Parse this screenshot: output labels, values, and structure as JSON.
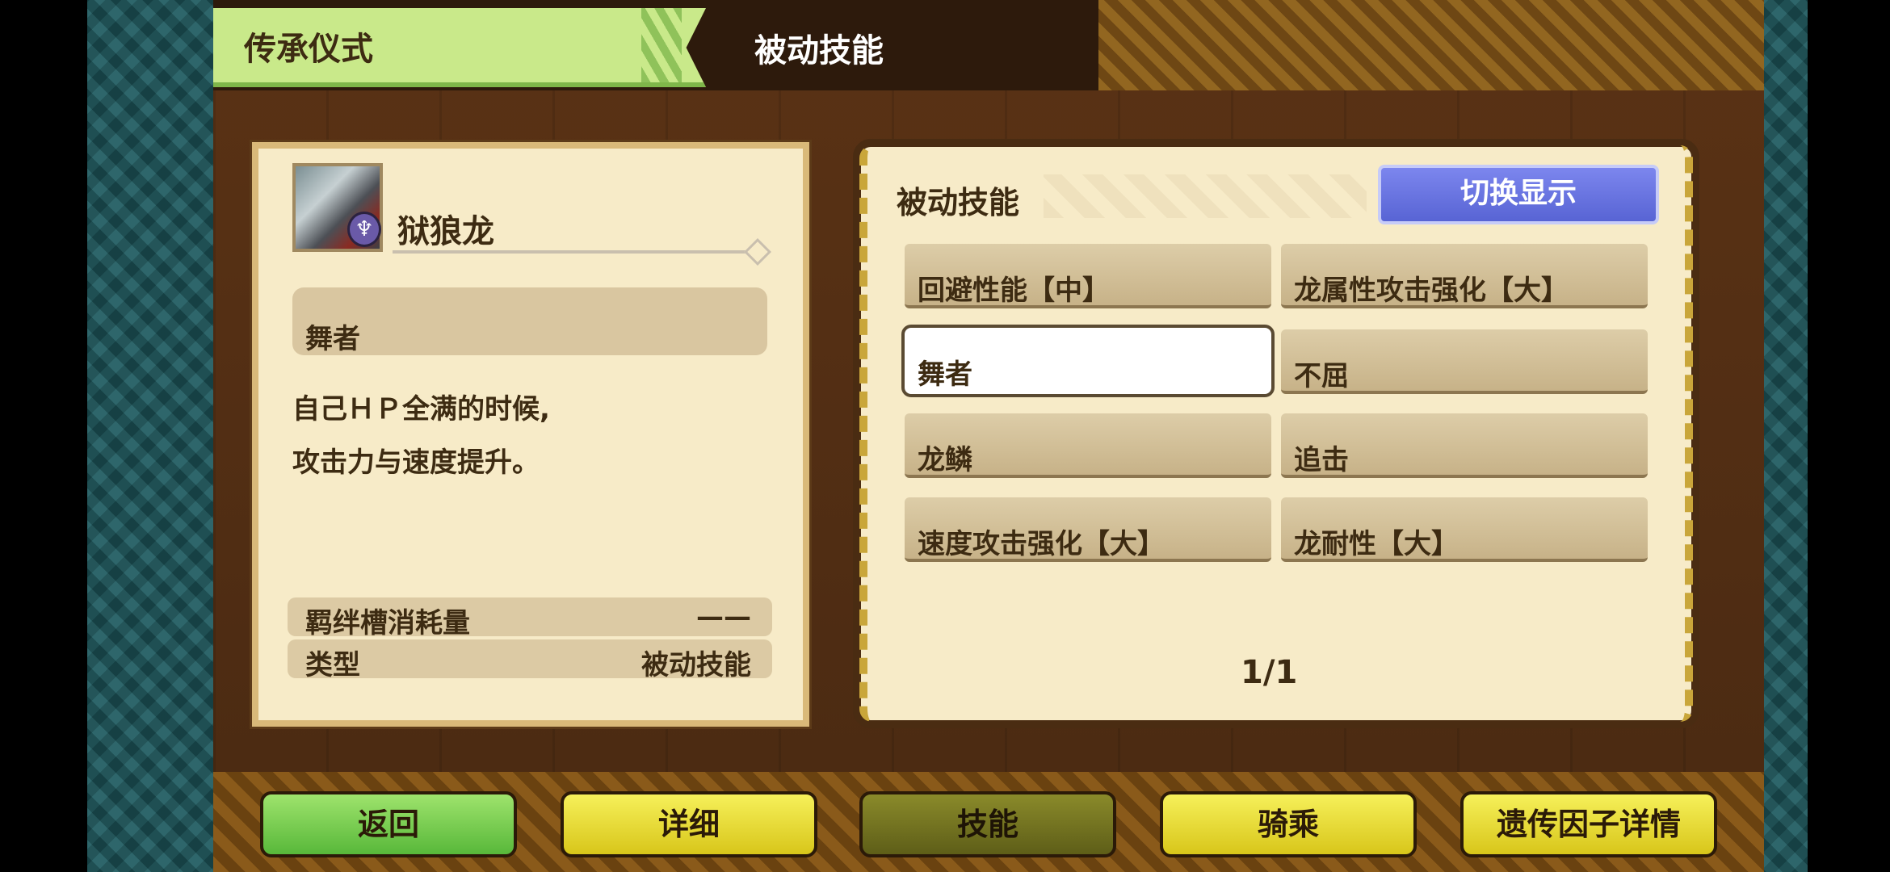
{
  "header": {
    "title": "传承仪式",
    "subtitle": "被动技能"
  },
  "monster": {
    "name": "狱狼龙",
    "selected_skill": "舞者",
    "description": [
      "自己ＨＰ全满的时候,",
      "攻击力与速度提升。"
    ],
    "stats": [
      {
        "label": "羁绊槽消耗量",
        "value": "——"
      },
      {
        "label": "类型",
        "value": "被动技能"
      }
    ]
  },
  "skills_panel": {
    "header": "被动技能",
    "switch_label": "切换显示",
    "skills": [
      "回避性能【中】",
      "龙属性攻击强化【大】",
      "舞者",
      "不屈",
      "龙鳞",
      "追击",
      "速度攻击强化【大】",
      "龙耐性【大】"
    ],
    "selected_index": 2,
    "page": "1/1"
  },
  "nav": {
    "buttons": [
      "返回",
      "详细",
      "技能",
      "骑乘",
      "遗传因子详情"
    ],
    "active_index": 2
  }
}
